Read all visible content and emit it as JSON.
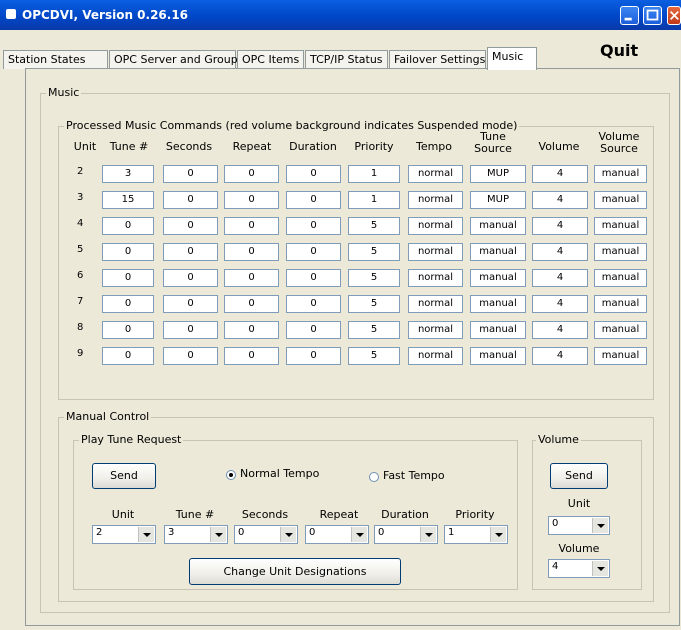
{
  "window": {
    "title": "OPCDVI, Version 0.26.16"
  },
  "tabs": [
    "Station States",
    "OPC Server and Group",
    "OPC Items",
    "TCP/IP Status",
    "Failover Settings",
    "Music"
  ],
  "active_tab": "Music",
  "quit_label": "Quit",
  "music": {
    "group_label": "Music",
    "processed_label": "Processed Music Commands (red volume background indicates Suspended mode)",
    "columns": [
      "Unit",
      "Tune #",
      "Seconds",
      "Repeat",
      "Duration",
      "Priority",
      "Tempo",
      "Tune Source",
      "Volume",
      "Volume Source"
    ],
    "rows": [
      {
        "unit": "2",
        "tune": "3",
        "seconds": "0",
        "repeat": "0",
        "duration": "0",
        "priority": "1",
        "tempo": "normal",
        "tune_source": "MUP",
        "volume": "4",
        "volume_source": "manual"
      },
      {
        "unit": "3",
        "tune": "15",
        "seconds": "0",
        "repeat": "0",
        "duration": "0",
        "priority": "1",
        "tempo": "normal",
        "tune_source": "MUP",
        "volume": "4",
        "volume_source": "manual"
      },
      {
        "unit": "4",
        "tune": "0",
        "seconds": "0",
        "repeat": "0",
        "duration": "0",
        "priority": "5",
        "tempo": "normal",
        "tune_source": "manual",
        "volume": "4",
        "volume_source": "manual"
      },
      {
        "unit": "5",
        "tune": "0",
        "seconds": "0",
        "repeat": "0",
        "duration": "0",
        "priority": "5",
        "tempo": "normal",
        "tune_source": "manual",
        "volume": "4",
        "volume_source": "manual"
      },
      {
        "unit": "6",
        "tune": "0",
        "seconds": "0",
        "repeat": "0",
        "duration": "0",
        "priority": "5",
        "tempo": "normal",
        "tune_source": "manual",
        "volume": "4",
        "volume_source": "manual"
      },
      {
        "unit": "7",
        "tune": "0",
        "seconds": "0",
        "repeat": "0",
        "duration": "0",
        "priority": "5",
        "tempo": "normal",
        "tune_source": "manual",
        "volume": "4",
        "volume_source": "manual"
      },
      {
        "unit": "8",
        "tune": "0",
        "seconds": "0",
        "repeat": "0",
        "duration": "0",
        "priority": "5",
        "tempo": "normal",
        "tune_source": "manual",
        "volume": "4",
        "volume_source": "manual"
      },
      {
        "unit": "9",
        "tune": "0",
        "seconds": "0",
        "repeat": "0",
        "duration": "0",
        "priority": "5",
        "tempo": "normal",
        "tune_source": "manual",
        "volume": "4",
        "volume_source": "manual"
      }
    ]
  },
  "manual_control": {
    "group_label": "Manual Control",
    "play_tune": {
      "label": "Play Tune Request",
      "send_label": "Send",
      "normal_tempo_label": "Normal Tempo",
      "fast_tempo_label": "Fast Tempo",
      "selected_tempo": "Normal Tempo",
      "fields": [
        {
          "label": "Unit",
          "value": "2"
        },
        {
          "label": "Tune #",
          "value": "3"
        },
        {
          "label": "Seconds",
          "value": "0"
        },
        {
          "label": "Repeat",
          "value": "0"
        },
        {
          "label": "Duration",
          "value": "0"
        },
        {
          "label": "Priority",
          "value": "1"
        }
      ],
      "change_unit_label": "Change Unit Designations"
    },
    "volume": {
      "label": "Volume",
      "send_label": "Send",
      "unit_label": "Unit",
      "unit_value": "0",
      "volume_label": "Volume",
      "volume_value": "4"
    }
  }
}
